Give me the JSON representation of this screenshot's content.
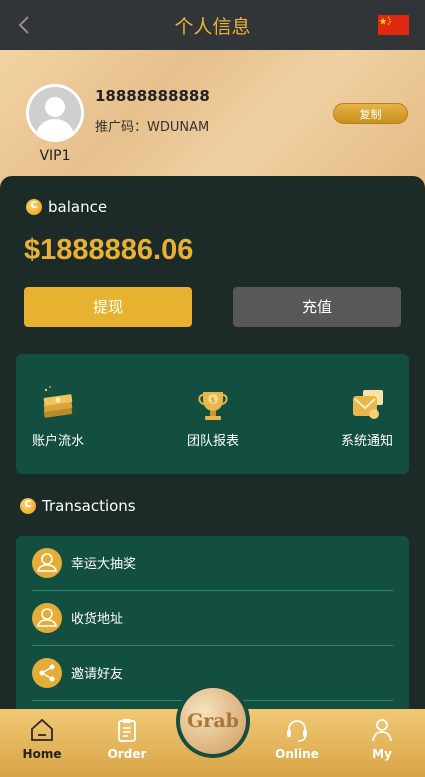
{
  "header": {
    "title": "个人信息",
    "back_icon": "chevron-left-icon",
    "flag_icon": "china-flag-icon"
  },
  "profile": {
    "avatar_icon": "user-avatar-icon",
    "phone": "18888888888",
    "referral_label": "推广码：",
    "referral_code": "WDUNAM",
    "copy_label": "复制",
    "vip_level": "VIP1"
  },
  "wallet": {
    "balance_label": "balance",
    "balance_amount": "$1888886.06",
    "withdraw_label": "提现",
    "recharge_label": "充值"
  },
  "quick_links": [
    {
      "label": "账户流水",
      "icon": "money-stack-icon"
    },
    {
      "label": "团队报表",
      "icon": "trophy-icon"
    },
    {
      "label": "系统通知",
      "icon": "notification-icon"
    }
  ],
  "transactions": {
    "title": "Transactions",
    "items": [
      {
        "label": "幸运大抽奖",
        "icon": "user-icon"
      },
      {
        "label": "收货地址",
        "icon": "user-icon"
      },
      {
        "label": "邀请好友",
        "icon": "share-icon"
      }
    ]
  },
  "tabbar": {
    "items": [
      {
        "label": "Home",
        "icon": "home-icon",
        "active": true
      },
      {
        "label": "Order",
        "icon": "order-clipboard-icon",
        "active": false
      },
      {
        "label": "Online",
        "icon": "headset-icon",
        "active": false
      },
      {
        "label": "My",
        "icon": "person-icon",
        "active": false
      }
    ],
    "grab_label": "Grab"
  },
  "colors": {
    "accent": "#e6b22f",
    "panel": "#134f40",
    "background": "#1c2b27",
    "topbar": "#323538"
  }
}
